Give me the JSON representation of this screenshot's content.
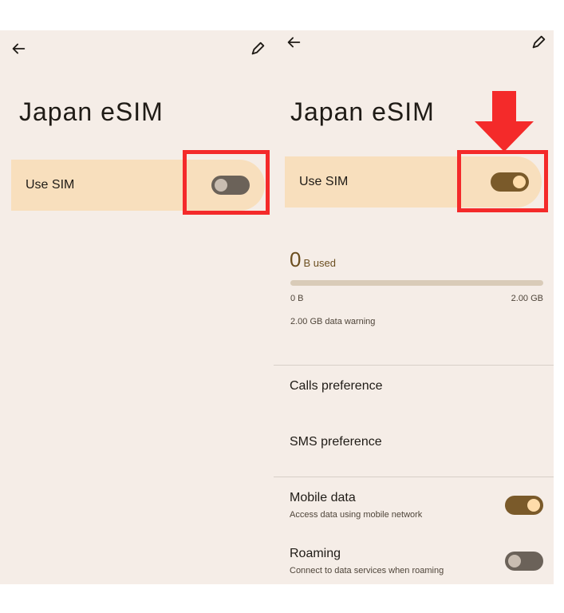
{
  "left_screen": {
    "title": "Japan eSIM",
    "use_sim_label": "Use SIM",
    "use_sim_state": "off"
  },
  "right_screen": {
    "title": "Japan eSIM",
    "use_sim_label": "Use SIM",
    "use_sim_state": "on",
    "data_usage": {
      "amount": "0",
      "unit_label": "B used",
      "range_start": "0 B",
      "range_end": "2.00 GB",
      "warning": "2.00 GB data warning",
      "fill_fraction": 0
    },
    "calls_preference": "Calls preference",
    "sms_preference": "SMS preference",
    "mobile_data": {
      "title": "Mobile data",
      "subtitle": "Access data using mobile network",
      "state": "on"
    },
    "roaming": {
      "title": "Roaming",
      "subtitle": "Connect to data services when roaming",
      "state": "off"
    }
  },
  "icons": {
    "back": "back-arrow-icon",
    "edit": "pencil-icon"
  },
  "colors": {
    "background": "#f5ede7",
    "card": "#f8dfbd",
    "toggle_on": "#7a5a2a",
    "toggle_off": "#6b6259",
    "highlight": "#f42a2a"
  }
}
